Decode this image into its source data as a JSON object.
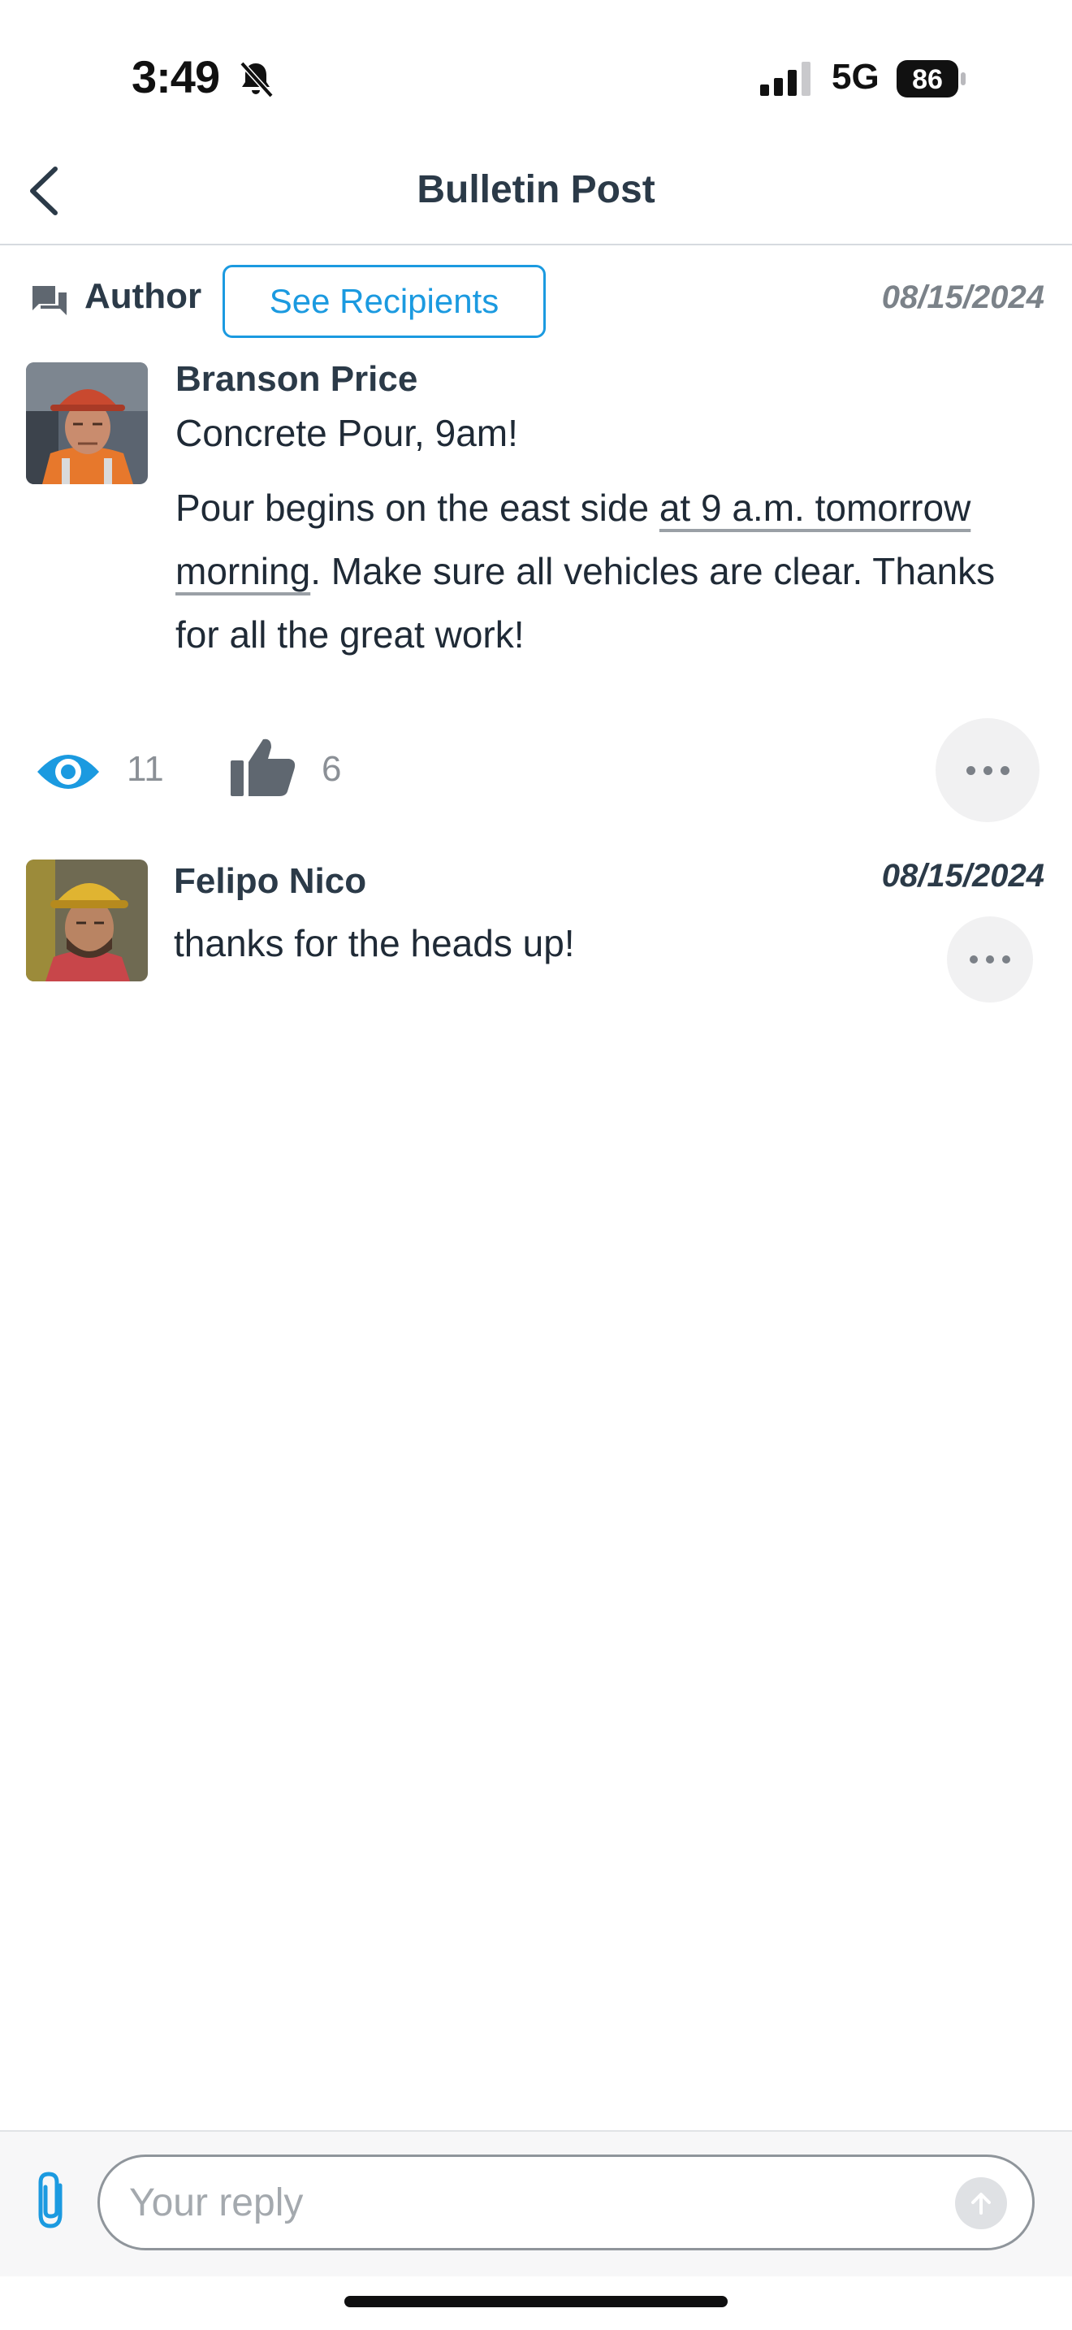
{
  "status_bar": {
    "time": "3:49",
    "network": "5G",
    "battery": "86",
    "icons": [
      "bell-slash-icon",
      "signal-icon",
      "battery-icon"
    ]
  },
  "header": {
    "title": "Bulletin Post",
    "back_icon": "chevron-left-icon"
  },
  "post": {
    "role_label": "Author",
    "see_recipients_label": "See Recipients",
    "date": "08/15/2024",
    "author_name": "Branson Price",
    "subject": "Concrete Pour, 9am!",
    "body_before": "Pour begins on the east side ",
    "body_link": "at 9 a.m. tomorrow morning",
    "body_after": ". Make sure all vehicles are clear. Thanks for all the great work!",
    "views": "11",
    "likes": "6"
  },
  "comments": [
    {
      "author_name": "Felipo Nico",
      "date": "08/15/2024",
      "text": "thanks for the heads up!"
    }
  ],
  "reply": {
    "placeholder": "Your reply"
  },
  "colors": {
    "accent": "#1b9ae0",
    "text": "#1f2a36",
    "muted": "#8b9096",
    "divider": "#d6dadf"
  }
}
